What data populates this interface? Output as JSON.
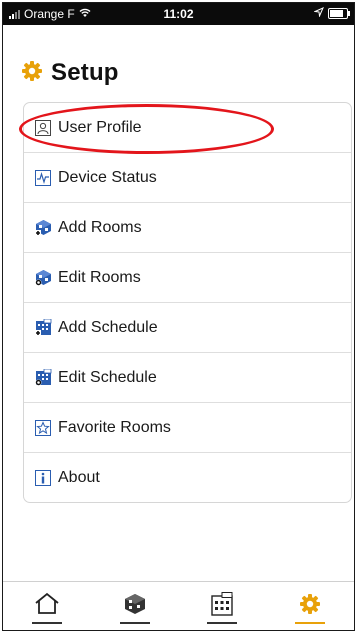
{
  "status_bar": {
    "carrier": "Orange F",
    "time": "11:02"
  },
  "header": {
    "title": "Setup",
    "icon": "gear-icon"
  },
  "menu": {
    "items": [
      {
        "label": "User Profile",
        "icon": "user-icon"
      },
      {
        "label": "Device Status",
        "icon": "pulse-icon"
      },
      {
        "label": "Add Rooms",
        "icon": "add-room-icon"
      },
      {
        "label": "Edit Rooms",
        "icon": "edit-room-icon"
      },
      {
        "label": "Add Schedule",
        "icon": "add-schedule-icon"
      },
      {
        "label": "Edit Schedule",
        "icon": "edit-schedule-icon"
      },
      {
        "label": "Favorite Rooms",
        "icon": "star-icon"
      },
      {
        "label": "About",
        "icon": "info-icon"
      }
    ]
  },
  "tab_bar": {
    "tabs": [
      {
        "icon": "home-icon",
        "active": false
      },
      {
        "icon": "rooms-icon",
        "active": false
      },
      {
        "icon": "schedule-icon",
        "active": false
      },
      {
        "icon": "gear-icon",
        "active": true
      }
    ]
  },
  "colors": {
    "accent": "#e8a10a",
    "highlight": "#e3151b",
    "icon_blue": "#2a5db0"
  }
}
